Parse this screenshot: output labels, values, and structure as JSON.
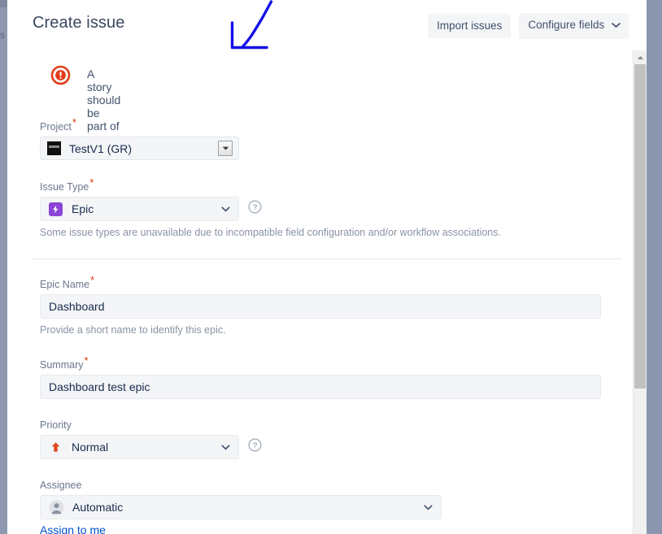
{
  "window": {
    "backdrop_ghost_text": "s",
    "scrollbar": {
      "position_pct": 0
    }
  },
  "header": {
    "title": "Create issue",
    "import_label": "Import issues",
    "configure_label": "Configure fields",
    "configure_caret": "∨"
  },
  "banner": {
    "icon": "error-circle-icon",
    "message": "A story should be part of an epic"
  },
  "form": {
    "project": {
      "label": "Project",
      "required": "*",
      "value": "TestV1 (GR)",
      "icon": "project-avatar-icon"
    },
    "issue_type": {
      "label": "Issue Type",
      "required": "*",
      "value": "Epic",
      "icon": "epic-type-icon",
      "help": "Some issue types are unavailable due to incompatible field configuration and/or workflow associations."
    },
    "epic_name": {
      "label": "Epic Name",
      "required": "*",
      "value": "Dashboard",
      "placeholder": "",
      "help": "Provide a short name to identify this epic."
    },
    "summary": {
      "label": "Summary",
      "required": "*",
      "value": "Dashboard test epic",
      "placeholder": ""
    },
    "priority": {
      "label": "Priority",
      "value": "Normal",
      "icon": "priority-major-arrow-icon"
    },
    "assignee": {
      "label": "Assignee",
      "value": "Automatic",
      "icon": "person-avatar-icon",
      "assign_to_me": "Assign to me"
    }
  },
  "colors": {
    "error_red": "#e03c1a",
    "required_red": "#de350b",
    "epic_purple": "#8b44d7",
    "link_blue": "#0052cc",
    "annotation_blue": "#1410e8",
    "title_navy": "#3b4761",
    "label_gray": "#6b778c",
    "field_bg": "#f4f5f7"
  }
}
